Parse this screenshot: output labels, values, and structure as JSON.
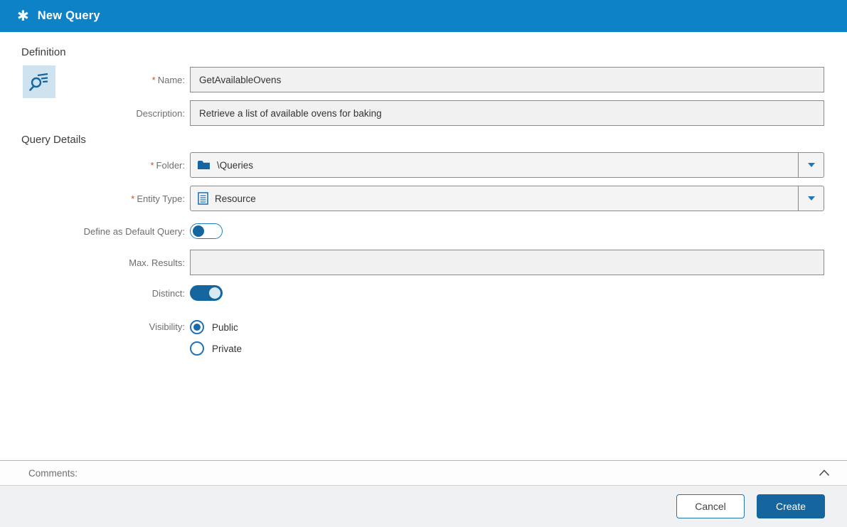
{
  "header": {
    "title": "New Query",
    "icon": "asterisk-icon",
    "asterisk_glyph": "✱"
  },
  "sections": {
    "definition": "Definition",
    "query_details": "Query Details"
  },
  "required_marker": "*",
  "fields": {
    "name": {
      "label": "Name:",
      "required": true,
      "value": "GetAvailableOvens"
    },
    "description": {
      "label": "Description:",
      "required": false,
      "value": "Retrieve a list of available ovens for baking"
    },
    "folder": {
      "label": "Folder:",
      "required": true,
      "value": "\\Queries",
      "icon": "folder-icon"
    },
    "entity_type": {
      "label": "Entity Type:",
      "required": true,
      "value": "Resource",
      "icon": "list-icon"
    },
    "default_query": {
      "label": "Define as Default Query:",
      "state": "off"
    },
    "max_results": {
      "label": "Max. Results:",
      "value": ""
    },
    "distinct": {
      "label": "Distinct:",
      "state": "on"
    },
    "visibility": {
      "label": "Visibility:",
      "options": [
        "Public",
        "Private"
      ],
      "selected": "Public",
      "option_states": [
        "checked",
        "unchecked"
      ]
    }
  },
  "comments": {
    "label": "Comments:",
    "collapse_icon": "chevron-up-icon"
  },
  "footer": {
    "cancel_label": "Cancel",
    "create_label": "Create"
  },
  "icons": {
    "definition_icon": "query-search-icon",
    "dropdown_icon": "chevron-down-icon"
  },
  "colors": {
    "header_bg": "#0d82c6",
    "accent_dark_blue": "#15659f",
    "accent_blue": "#2272b8",
    "icon_bg_light_blue": "#cfe2f0",
    "field_bg": "#f1f1f1",
    "field_border": "#8a8a8a",
    "label_gray": "#6e6e6e",
    "required_orange": "#c0531f",
    "footer_bg": "#f0f1f2"
  }
}
